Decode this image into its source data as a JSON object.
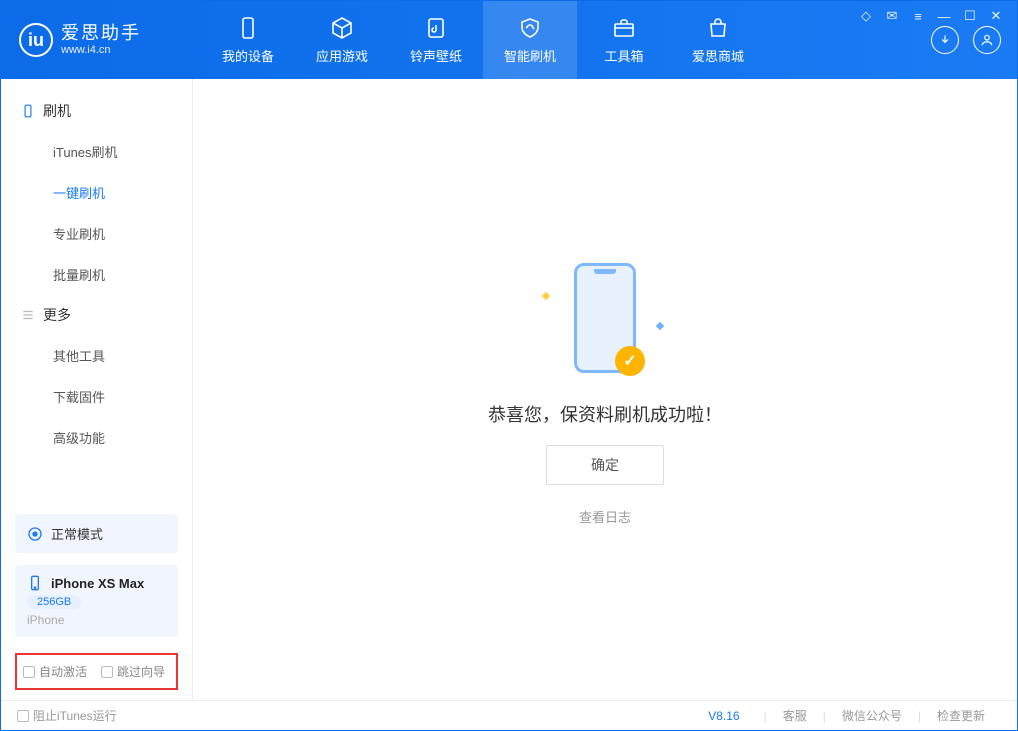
{
  "brand": {
    "title": "爱思助手",
    "subtitle": "www.i4.cn"
  },
  "nav": {
    "mydevice": "我的设备",
    "appgame": "应用游戏",
    "ringtone": "铃声壁纸",
    "smartflash": "智能刷机",
    "toolbox": "工具箱",
    "store": "爱思商城"
  },
  "sidebar": {
    "section_flash": "刷机",
    "items_flash": {
      "itunes": "iTunes刷机",
      "oneclick": "一键刷机",
      "pro": "专业刷机",
      "batch": "批量刷机"
    },
    "section_more": "更多",
    "items_more": {
      "other": "其他工具",
      "firmware": "下载固件",
      "advanced": "高级功能"
    }
  },
  "mode_card": {
    "label": "正常模式"
  },
  "device_card": {
    "name": "iPhone XS Max",
    "storage": "256GB",
    "type": "iPhone"
  },
  "options": {
    "auto_activate": "自动激活",
    "skip_guide": "跳过向导"
  },
  "main": {
    "success_text": "恭喜您，保资料刷机成功啦！",
    "ok_label": "确定",
    "log_link": "查看日志"
  },
  "footer": {
    "block_itunes": "阻止iTunes运行",
    "version": "V8.16",
    "support": "客服",
    "wechat": "微信公众号",
    "update": "检查更新"
  }
}
